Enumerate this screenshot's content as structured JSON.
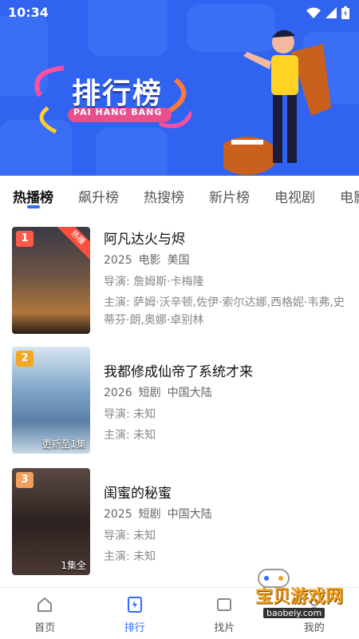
{
  "status_bar": {
    "time": "10:34"
  },
  "banner": {
    "title": "排行榜",
    "subtitle": "PAI HANG BANG"
  },
  "tabs": [
    {
      "label": "热播榜",
      "active": true
    },
    {
      "label": "飙升榜",
      "active": false
    },
    {
      "label": "热搜榜",
      "active": false
    },
    {
      "label": "新片榜",
      "active": false
    },
    {
      "label": "电视剧",
      "active": false
    },
    {
      "label": "电影",
      "active": false
    }
  ],
  "items": [
    {
      "rank": "1",
      "badge": "热播",
      "title": "阿凡达火与烬",
      "year": "2025",
      "type": "电影",
      "region": "美国",
      "director": "导演: 詹姆斯·卡梅隆",
      "cast": "主演: 萨姆·沃辛顿,佐伊·索尔达娜,西格妮·韦弗,史蒂芬·朗,奥娜·卓别林",
      "poster_note": "",
      "poster_color": "#5a4a3c",
      "rank_color": "#ff5a4a"
    },
    {
      "rank": "2",
      "badge": "",
      "title": "我都修成仙帝了系统才来",
      "year": "2026",
      "type": "短剧",
      "region": "中国大陆",
      "director": "导演: 未知",
      "cast": "主演: 未知",
      "poster_note": "更新至1集",
      "poster_color": "#7a9fc4",
      "rank_color": "#f5a623"
    },
    {
      "rank": "3",
      "badge": "",
      "title": "闺蜜的秘蜜",
      "year": "2025",
      "type": "短剧",
      "region": "中国大陆",
      "director": "导演: 未知",
      "cast": "主演: 未知",
      "poster_note": "1集全",
      "poster_color": "#3c2e2c",
      "rank_color": "#f0a05a"
    }
  ],
  "bottom_nav": [
    {
      "label": "首页",
      "icon": "home-icon",
      "active": false
    },
    {
      "label": "排行",
      "icon": "ranking-icon",
      "active": true
    },
    {
      "label": "找片",
      "icon": "search-film-icon",
      "active": false
    },
    {
      "label": "我的",
      "icon": "profile-icon",
      "active": false
    }
  ],
  "watermark": {
    "text": "宝贝游戏网",
    "url": "baobeiy.com"
  }
}
